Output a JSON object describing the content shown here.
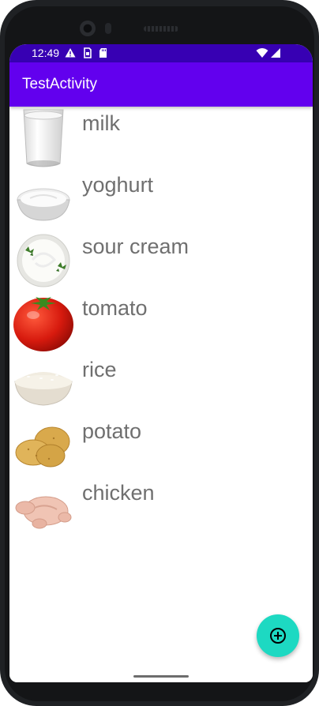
{
  "status_bar": {
    "time": "12:49",
    "icons": [
      "warning-icon",
      "sim-icon",
      "sd-card-icon",
      "wifi-icon",
      "signal-icon"
    ],
    "background": "#3700b3"
  },
  "app_bar": {
    "title": "TestActivity",
    "background": "#6200ee"
  },
  "items": [
    {
      "label": "milk",
      "image": "milk-glass-image"
    },
    {
      "label": "yoghurt",
      "image": "yoghurt-bowl-image"
    },
    {
      "label": "sour cream",
      "image": "sour-cream-bowl-image"
    },
    {
      "label": "tomato",
      "image": "tomato-image"
    },
    {
      "label": "rice",
      "image": "rice-bowl-image"
    },
    {
      "label": "potato",
      "image": "potatoes-image"
    },
    {
      "label": "chicken",
      "image": "raw-chicken-image"
    }
  ],
  "fab": {
    "icon": "add-circle-icon",
    "color": "#1dd9c2"
  }
}
